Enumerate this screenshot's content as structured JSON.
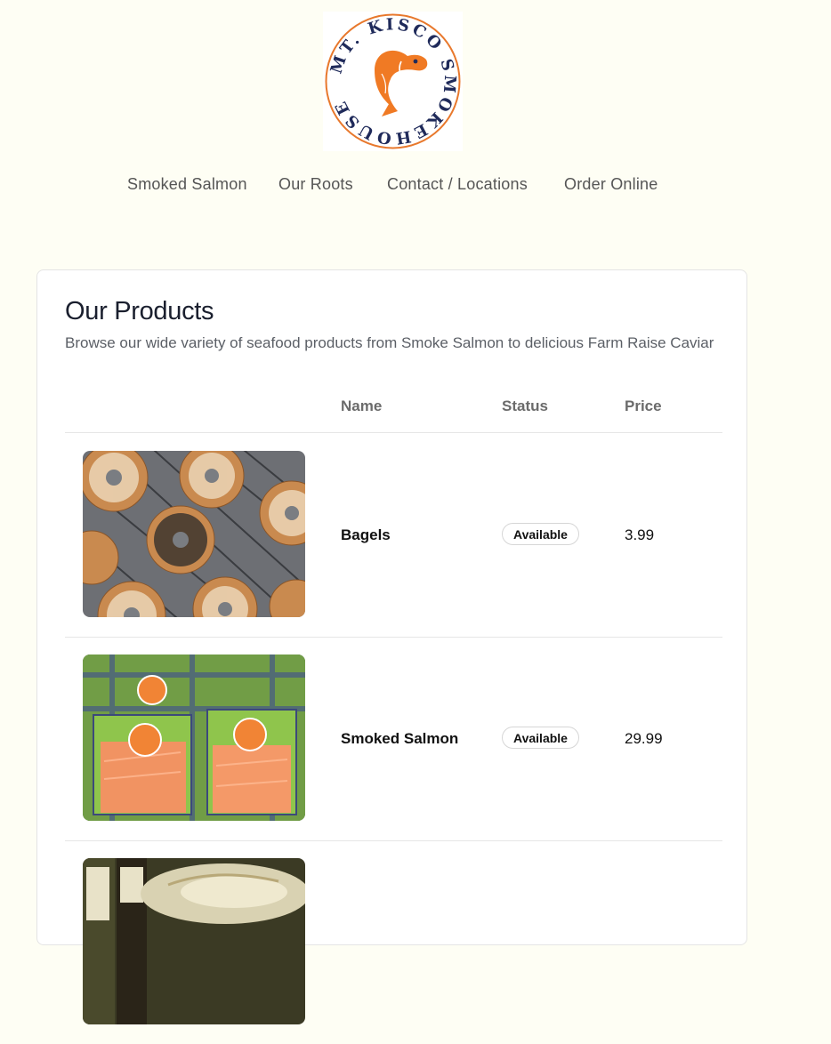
{
  "logo": {
    "text": "MT. KISCO SMOKEHOUSE",
    "colors": {
      "ring": "#e8782c",
      "text": "#1f2a5a",
      "fish": "#f07a24"
    }
  },
  "nav": {
    "items": [
      {
        "label": "Smoked Salmon"
      },
      {
        "label": "Our Roots"
      },
      {
        "label": "Contact / Locations"
      },
      {
        "label": "Order Online"
      }
    ]
  },
  "products_card": {
    "title": "Our Products",
    "subtitle": "Browse our wide variety of seafood products from Smoke Salmon to delicious Farm Raise Caviar",
    "columns": {
      "name": "Name",
      "status": "Status",
      "price": "Price"
    },
    "rows": [
      {
        "name": "Bagels",
        "status": "Available",
        "price": "3.99",
        "image": "bagels-photo"
      },
      {
        "name": "Smoked Salmon",
        "status": "Available",
        "price": "29.99",
        "image": "smoked-salmon-photo"
      },
      {
        "name": "",
        "status": "",
        "price": "",
        "image": "olive-oil-vinegar-photo"
      }
    ]
  }
}
